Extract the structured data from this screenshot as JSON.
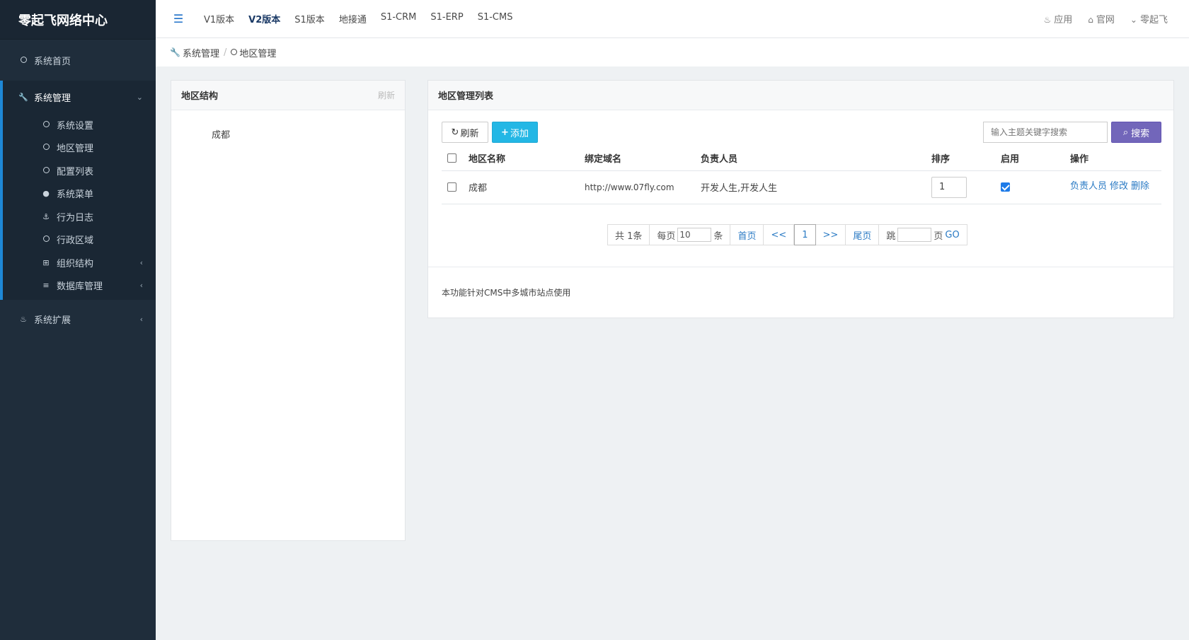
{
  "brand": {
    "title": "零起飞网络中心"
  },
  "sidebar": {
    "home": "系统首页",
    "group": {
      "label": "系统管理",
      "items": [
        {
          "label": "系统设置",
          "icon": "circle-icon"
        },
        {
          "label": "地区管理",
          "icon": "circle-icon"
        },
        {
          "label": "配置列表",
          "icon": "circle-icon"
        },
        {
          "label": "系统菜单",
          "icon": "user-icon"
        },
        {
          "label": "行为日志",
          "icon": "anchor-icon"
        },
        {
          "label": "行政区域",
          "icon": "circle-icon"
        },
        {
          "label": "组织结构",
          "icon": "sitemap-icon"
        },
        {
          "label": "数据库管理",
          "icon": "database-icon"
        }
      ]
    },
    "extension": "系统扩展"
  },
  "header": {
    "nav": [
      "V1版本",
      "V2版本",
      "S1版本",
      "地接通",
      "S1-CRM",
      "S1-ERP",
      "S1-CMS"
    ],
    "active": "V2版本",
    "right": {
      "apps": "应用",
      "site": "官网",
      "user": "零起飞"
    }
  },
  "breadcrumb": {
    "parent": "系统管理",
    "current": "地区管理"
  },
  "left_panel": {
    "title": "地区结构",
    "refresh": "刷新",
    "tree": [
      "成都"
    ]
  },
  "right_panel": {
    "title": "地区管理列表",
    "buttons": {
      "refresh": "刷新",
      "add": "添加",
      "search": "搜索"
    },
    "search_placeholder": "输入主题关键字搜索",
    "columns": [
      "地区名称",
      "绑定域名",
      "负责人员",
      "排序",
      "启用",
      "操作"
    ],
    "rows": [
      {
        "name": "成都",
        "domain": "http://www.07fly.com",
        "owner": "开发人生,开发人生",
        "sort": "1",
        "enabled": true,
        "actions": [
          "负责人员",
          "修改",
          "删除"
        ]
      }
    ],
    "pager": {
      "total": "共 1条",
      "per_page_label": "每页",
      "per_page": "10",
      "unit": "条",
      "first": "首页",
      "prev": "<<",
      "current": "1",
      "next": ">>",
      "last": "尾页",
      "jump_label": "跳",
      "page_label": "页",
      "go": "GO"
    },
    "footer_note": "本功能针对CMS中多城市站点使用"
  },
  "colors": {
    "sidebar": "#1f2d3b",
    "accent": "#1e88d6",
    "add_button": "#23b7e5",
    "search_button": "#7266ba",
    "link": "#2a7ac4"
  }
}
